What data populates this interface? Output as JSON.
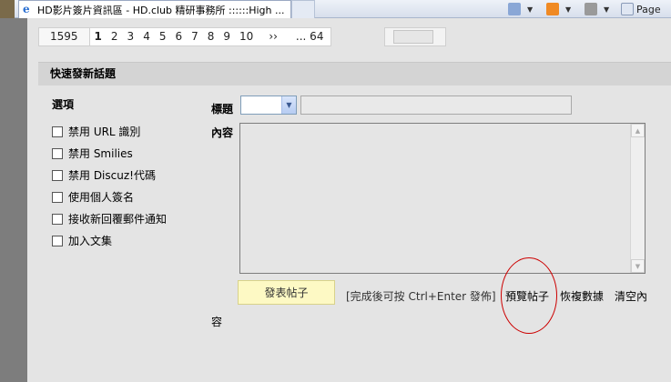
{
  "browser": {
    "tab_title": "HD影片簽片資訊區 - HD.club 精研事務所 ::::::High ...",
    "tab_icon": "ie-icon",
    "toolbar": {
      "home_icon": "home-icon",
      "feeds_icon": "rss-icon",
      "print_icon": "print-icon",
      "page_label": "Page"
    }
  },
  "pagination": {
    "total": "1595",
    "current": "1",
    "pages": [
      "2",
      "3",
      "4",
      "5",
      "6",
      "7",
      "8",
      "9",
      "10"
    ],
    "next": "››",
    "last": "... 64"
  },
  "section": {
    "title": "快速發新話題"
  },
  "options": {
    "title": "選項",
    "items": [
      "禁用 URL 識別",
      "禁用 Smilies",
      "禁用 Discuz!代碼",
      "使用個人簽名",
      "接收新回覆郵件通知",
      "加入文集"
    ]
  },
  "form": {
    "subject_label": "標題",
    "content_label": "內容",
    "subject_value": "",
    "content_value": ""
  },
  "actions": {
    "post_button": "發表帖子",
    "hint": "[完成後可按 Ctrl+Enter 發佈]",
    "preview": "預覽帖子",
    "restore": "恢複數據",
    "clear_part1": "清空內",
    "clear_part2": "容"
  },
  "colors": {
    "annotation_circle": "#cc0000",
    "current_page": "#1a7a1a",
    "post_button_bg": "#fdf9c4"
  }
}
